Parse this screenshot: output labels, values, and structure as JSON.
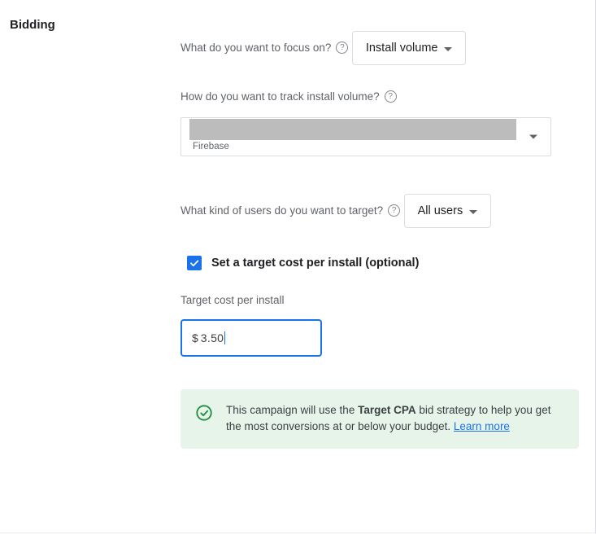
{
  "section": {
    "title": "Bidding"
  },
  "focus": {
    "label": "What do you want to focus on?",
    "selected": "Install volume"
  },
  "track": {
    "label": "How do you want to track install volume?",
    "selected_subtext": "Firebase"
  },
  "users": {
    "label": "What kind of users do you want to target?",
    "selected": "All users"
  },
  "checkbox": {
    "label": "Set a target cost per install (optional)",
    "checked": true
  },
  "target": {
    "label": "Target cost per install",
    "currency": "$",
    "value": "3.50"
  },
  "banner": {
    "pre": "This campaign will use the ",
    "bold": "Target CPA",
    "post": " bid strategy to help you get the most conversions at or below your budget. ",
    "link": "Learn more"
  }
}
